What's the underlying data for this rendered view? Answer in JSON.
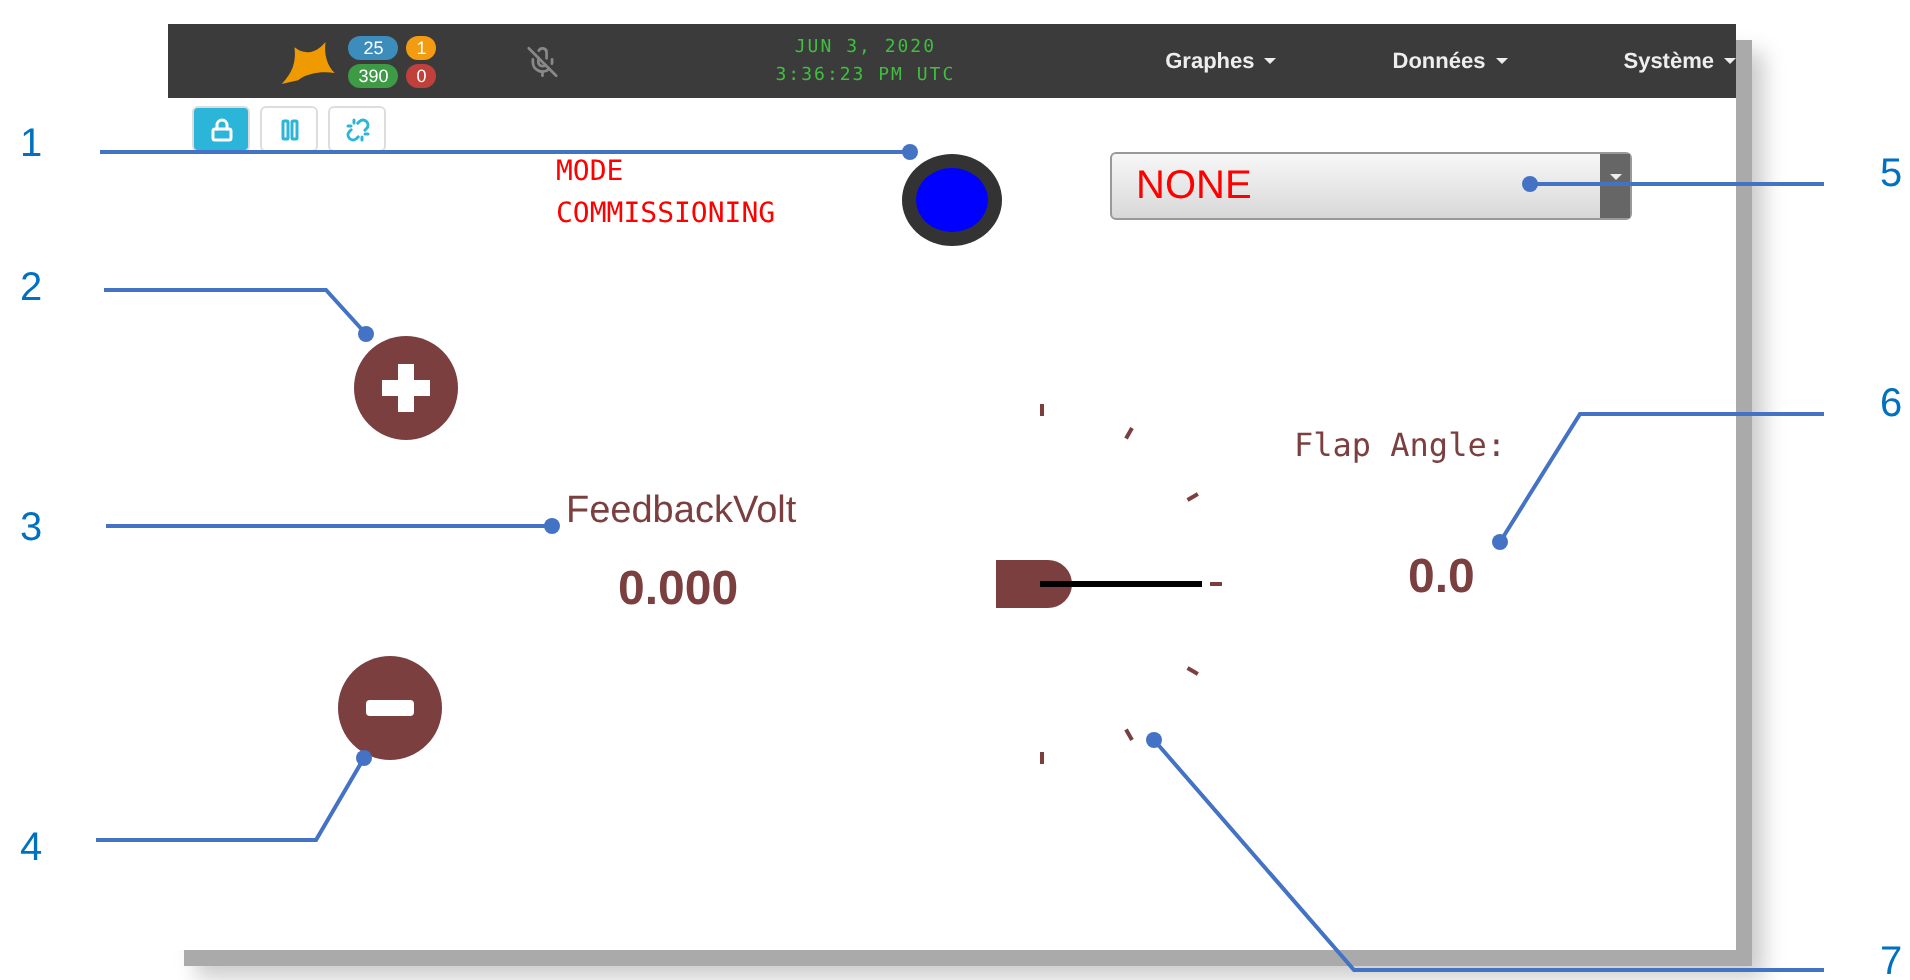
{
  "navbar": {
    "badges": [
      {
        "text": "25",
        "color": "#3c8dbc"
      },
      {
        "text": "1",
        "color": "#f39c12"
      },
      {
        "text": "390",
        "color": "#3d9a45"
      },
      {
        "text": "0",
        "color": "#c0413b"
      }
    ],
    "clock": [
      "JUN 3, 2020",
      "3:36:23 PM UTC"
    ],
    "menus": [
      "Graphes",
      "Données",
      "Système"
    ]
  },
  "toolbar": {
    "buttons": [
      {
        "kind": "lock",
        "selected": true
      },
      {
        "kind": "pause",
        "selected": false
      },
      {
        "kind": "unlink",
        "selected": false
      }
    ]
  },
  "mode_text": [
    "MODE",
    "COMMISSIONING"
  ],
  "status_light": {
    "color": "#0000ff"
  },
  "dropdown": {
    "value": "NONE"
  },
  "feedback": {
    "label": "FeedbackVolt",
    "value": "0.000"
  },
  "flap": {
    "label": "Flap Angle:",
    "value": "0.0"
  },
  "callouts": [
    {
      "number": "1"
    },
    {
      "number": "2"
    },
    {
      "number": "3"
    },
    {
      "number": "4"
    },
    {
      "number": "5"
    },
    {
      "number": "6"
    },
    {
      "number": "7"
    }
  ]
}
